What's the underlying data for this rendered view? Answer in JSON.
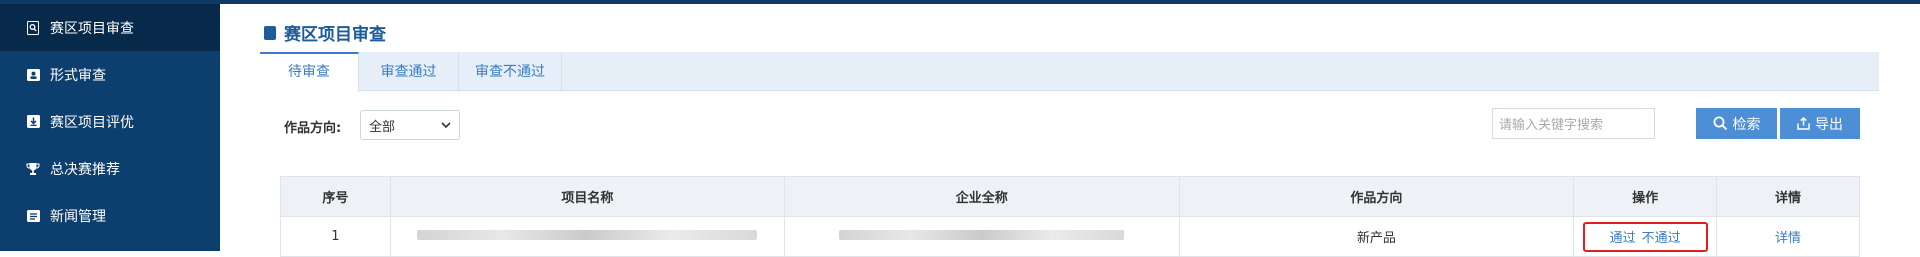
{
  "sidebar": {
    "items": [
      {
        "label": "赛区项目审查",
        "icon": "search-doc-icon",
        "active": true
      },
      {
        "label": "形式审查",
        "icon": "id-card-icon",
        "active": false
      },
      {
        "label": "赛区项目评优",
        "icon": "download-box-icon",
        "active": false
      },
      {
        "label": "总决赛推荐",
        "icon": "trophy-icon",
        "active": false
      },
      {
        "label": "新闻管理",
        "icon": "news-icon",
        "active": false
      }
    ]
  },
  "page": {
    "title": "赛区项目审查",
    "title_icon": "bookmark-icon"
  },
  "tabs": [
    {
      "label": "待审查",
      "active": true
    },
    {
      "label": "审查通过",
      "active": false
    },
    {
      "label": "审查不通过",
      "active": false
    }
  ],
  "filter": {
    "label": "作品方向:",
    "selected": "全部"
  },
  "search": {
    "placeholder": "请输入关键字搜索",
    "search_label": "检索",
    "export_label": "导出"
  },
  "table": {
    "columns": [
      "序号",
      "项目名称",
      "企业全称",
      "作品方向",
      "操作",
      "详情"
    ],
    "rows": [
      {
        "index": "1",
        "project_name": "",
        "company_name": "",
        "direction": "新产品",
        "pass_label": "通过",
        "reject_label": "不通过",
        "detail_label": "详情"
      }
    ]
  },
  "colors": {
    "sidebar_bg": "#0d3f6e",
    "sidebar_active": "#082a4a",
    "accent": "#3a7cc7",
    "button": "#4d8fd6",
    "highlight_border": "#e02020"
  }
}
